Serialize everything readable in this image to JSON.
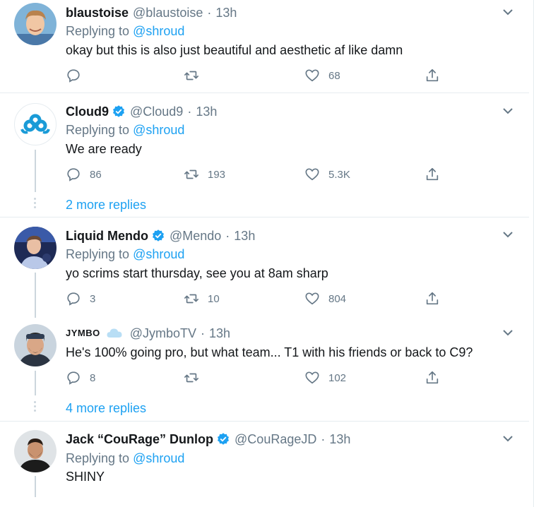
{
  "tweets": [
    {
      "name": "blaustoise",
      "handle": "@blaustoise",
      "time": "13h",
      "replying_prefix": "Replying to",
      "replying_to": "@shroud",
      "text": "okay but this is also just beautiful and aesthetic af like damn",
      "reply_count": "",
      "retweet_count": "",
      "like_count": "68"
    },
    {
      "name": "Cloud9",
      "handle": "@Cloud9",
      "time": "13h",
      "replying_prefix": "Replying to",
      "replying_to": "@shroud",
      "text": "We are ready",
      "reply_count": "86",
      "retweet_count": "193",
      "like_count": "5.3K",
      "more_replies": "2 more replies"
    },
    {
      "name": "Liquid Mendo",
      "handle": "@Mendo",
      "time": "13h",
      "replying_prefix": "Replying to",
      "replying_to": "@shroud",
      "text": "yo scrims start thursday, see you at 8am sharp",
      "reply_count": "3",
      "retweet_count": "10",
      "like_count": "804"
    },
    {
      "name": "JYMBO",
      "handle": "@JymboTV",
      "time": "13h",
      "text": "He's 100% going pro, but what team... T1 with his friends or back to C9?",
      "reply_count": "8",
      "retweet_count": "",
      "like_count": "102",
      "more_replies": "4 more replies"
    },
    {
      "name": "Jack “CouRage” Dunlop",
      "handle": "@CouRageJD",
      "time": "13h",
      "replying_prefix": "Replying to",
      "replying_to": "@shroud",
      "text": "SHINY"
    }
  ],
  "separator": "·",
  "colors": {
    "accent": "#1da1f2",
    "secondary_text": "#657786",
    "primary_text": "#14171a",
    "border": "#e6ecf0"
  },
  "icons": [
    "reply-icon",
    "retweet-icon",
    "like-icon",
    "share-icon",
    "chevron-down-icon",
    "verified-badge-icon"
  ]
}
